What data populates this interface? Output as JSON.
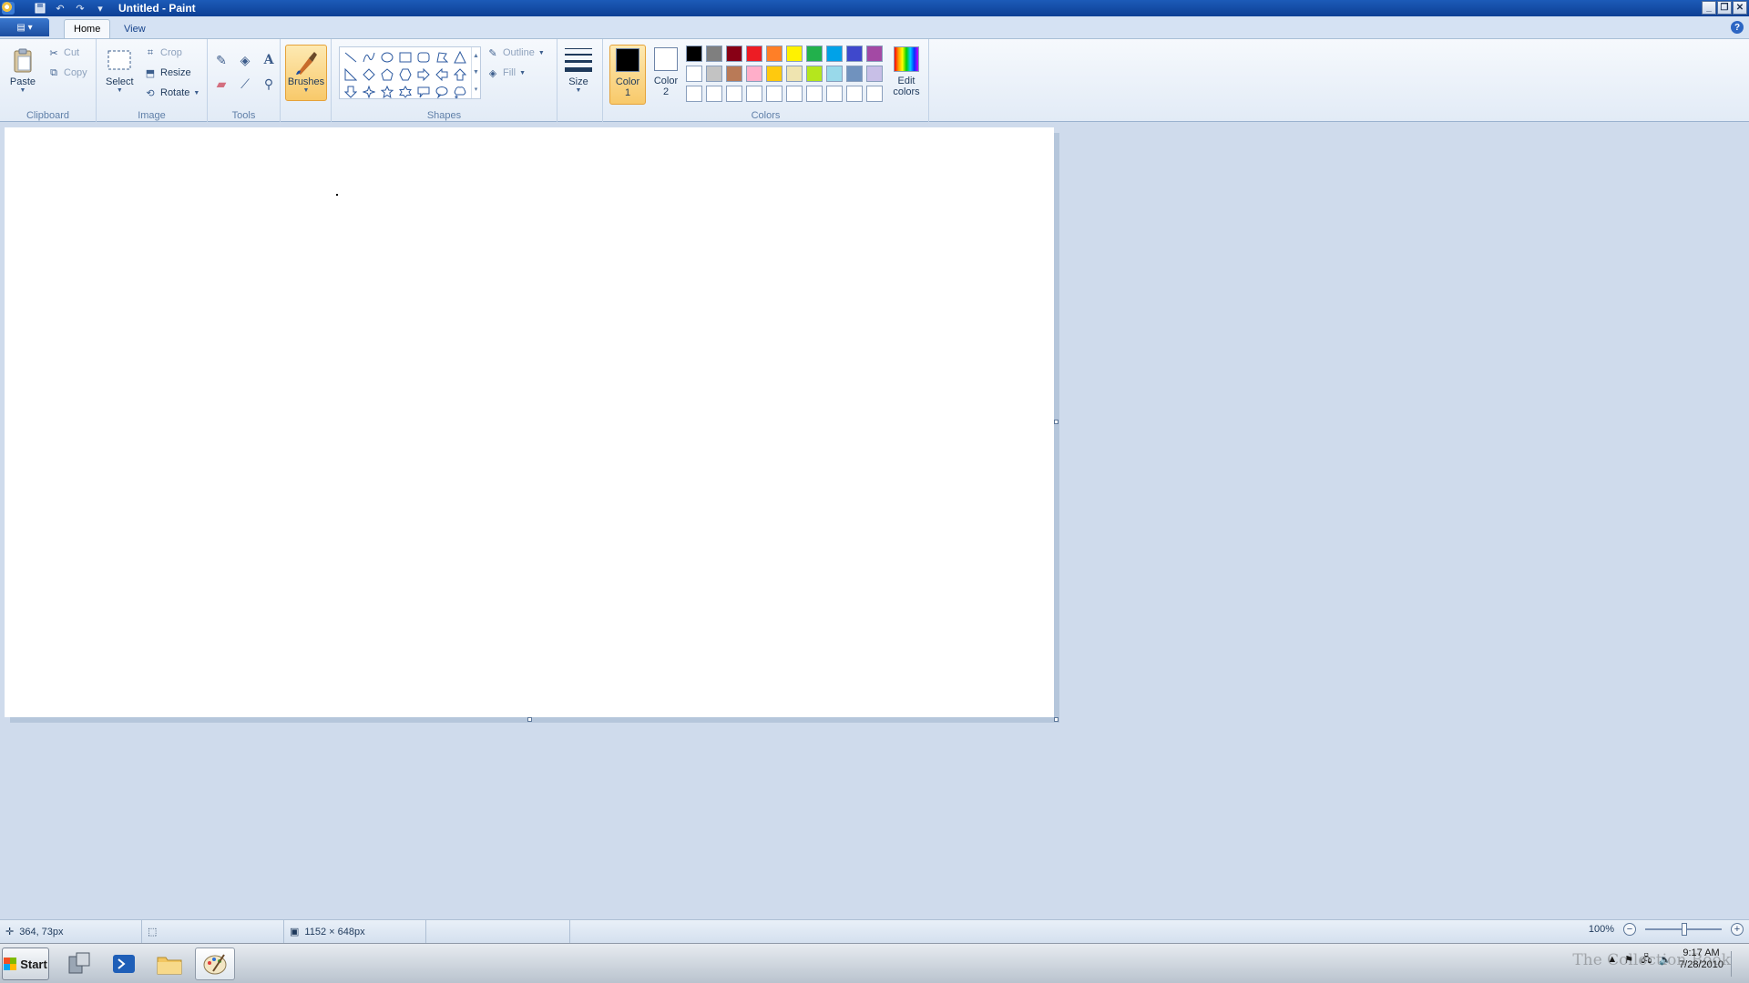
{
  "window": {
    "title": "Untitled - Paint",
    "controls": [
      "minimize",
      "restore",
      "close"
    ]
  },
  "ribbon": {
    "tabs": [
      {
        "label": "Home",
        "active": true
      },
      {
        "label": "View",
        "active": false
      }
    ],
    "groups": {
      "clipboard": {
        "label": "Clipboard",
        "paste": "Paste",
        "cut": "Cut",
        "copy": "Copy"
      },
      "image": {
        "label": "Image",
        "select": "Select",
        "crop": "Crop",
        "resize": "Resize",
        "rotate": "Rotate"
      },
      "tools": {
        "label": "Tools"
      },
      "brushes": {
        "label": "Brushes"
      },
      "shapes": {
        "label": "Shapes",
        "outline": "Outline",
        "fill": "Fill"
      },
      "size": {
        "label": "Size"
      },
      "colors": {
        "label": "Colors",
        "color1_line1": "Color",
        "color1_line2": "1",
        "color2_line1": "Color",
        "color2_line2": "2",
        "color1_value": "#000000",
        "color2_value": "#ffffff",
        "edit_line1": "Edit",
        "edit_line2": "colors",
        "palette": [
          "#000000",
          "#7f7f7f",
          "#880015",
          "#ed1c24",
          "#ff7f27",
          "#fff200",
          "#22b14c",
          "#00a2e8",
          "#3f48cc",
          "#a349a4",
          "#ffffff",
          "#c3c3c3",
          "#b97a57",
          "#ffaec9",
          "#ffc90e",
          "#efe4b0",
          "#b5e61d",
          "#99d9ea",
          "#7092be",
          "#c8bfe7",
          "#ffffff",
          "#ffffff",
          "#ffffff",
          "#ffffff",
          "#ffffff",
          "#ffffff",
          "#ffffff",
          "#ffffff",
          "#ffffff",
          "#ffffff"
        ]
      }
    }
  },
  "statusbar": {
    "cursor_pos": "364, 73px",
    "image_size": "1152 × 648px",
    "zoom": "100%",
    "zoom_level": 1.0
  },
  "taskbar": {
    "start_label": "Start",
    "time": "9:17 AM",
    "date": "7/28/2010",
    "watermark": "The Collection Book"
  },
  "colors": {
    "titlebar": "#0d3f94",
    "accent_active": "#f8c96a",
    "workspace": "#cfdbec"
  }
}
